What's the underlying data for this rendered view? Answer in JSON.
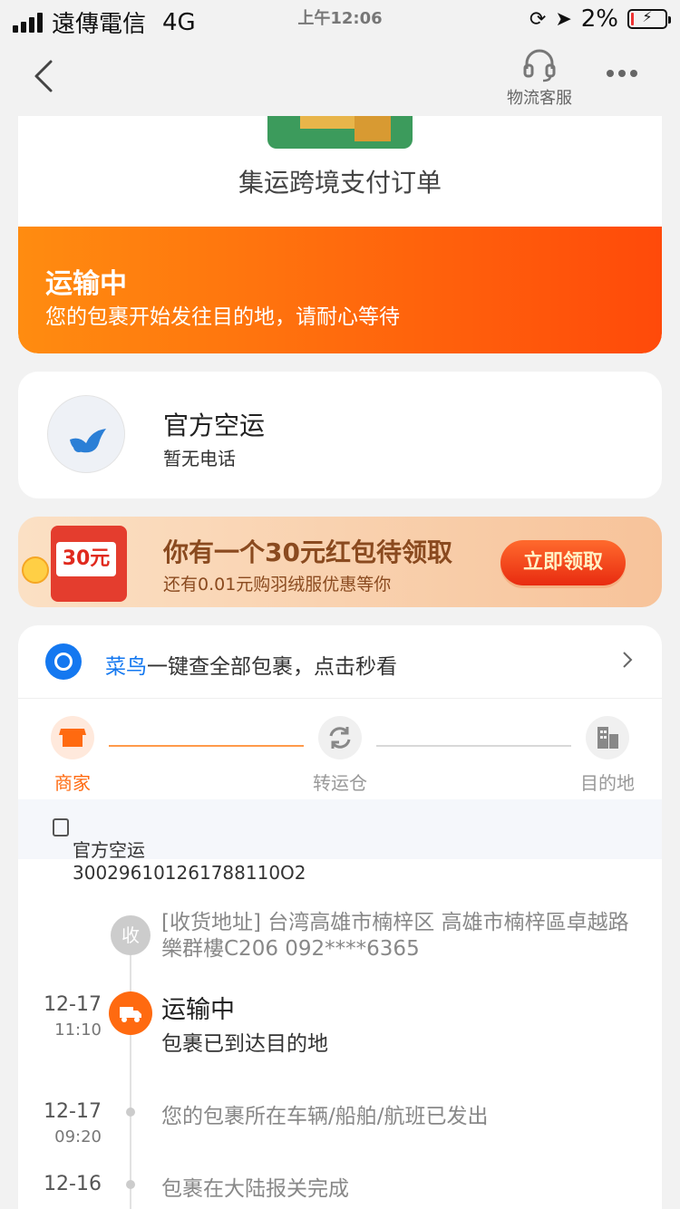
{
  "status_bar": {
    "carrier": "遠傳電信",
    "network": "4G",
    "time": "上午12:06",
    "battery": "2%"
  },
  "nav": {
    "service_label": "物流客服"
  },
  "order": {
    "title": "集运跨境支付订单",
    "status": "运输中",
    "status_desc": "您的包裹开始发往目的地，请耐心等待"
  },
  "carrier": {
    "name": "官方空运",
    "phone": "暂无电话"
  },
  "banner": {
    "tag": "30元",
    "title": "你有一个30元红包待领取",
    "subtitle": "还有0.01元购羽绒服优惠等你",
    "button": "立即领取"
  },
  "cainiao": {
    "brand": "菜鸟",
    "text": "一键查全部包裹，点击秒看"
  },
  "steps": [
    {
      "label": "商家"
    },
    {
      "label": "转运仓"
    },
    {
      "label": "目的地"
    }
  ],
  "waybill": {
    "text": "官方空运 300296101261788110O2"
  },
  "timeline": {
    "recv_badge": "收",
    "recv_address": "[收货地址] 台湾高雄市楠梓区 高雄市楠梓區卓越路樂群樓C206 092****6365",
    "events": [
      {
        "date": "12-17",
        "time": "11:10",
        "title": "运输中",
        "desc": "包裹已到达目的地"
      },
      {
        "date": "12-17",
        "time": "09:20",
        "desc": "您的包裹所在车辆/船舶/航班已发出"
      },
      {
        "date": "12-16",
        "desc": "包裹在大陆报关完成"
      }
    ]
  }
}
